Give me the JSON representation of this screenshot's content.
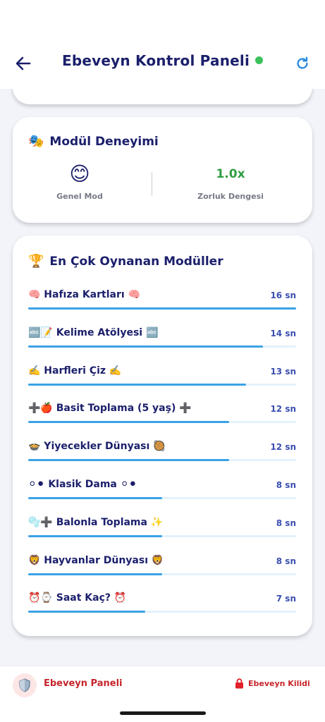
{
  "header": {
    "title": "Ebeveyn Kontrol Paneli",
    "back_icon": "arrow-left-icon",
    "refresh_icon": "refresh-icon",
    "status_color": "#3cc15a"
  },
  "module_experience": {
    "title": "Modül Deneyimi",
    "title_emoji": "🎭",
    "mode_emoji": "😊",
    "mode_label": "Genel Mod",
    "difficulty_value": "1.0x",
    "difficulty_label": "Zorluk Dengesi"
  },
  "top_modules": {
    "title": "En Çok Oynanan Modüller",
    "title_emoji": "🏆",
    "items": [
      {
        "name": "🧠 Hafıza Kartları 🧠",
        "value": "16 sn",
        "seconds": 16
      },
      {
        "name": "🔤📝 Kelime Atölyesi 🔤",
        "value": "14 sn",
        "seconds": 14
      },
      {
        "name": "✍️ Harfleri Çiz ✍️",
        "value": "13 sn",
        "seconds": 13
      },
      {
        "name": "➕🍎 Basit Toplama (5 yaş) ➕",
        "value": "12 sn",
        "seconds": 12
      },
      {
        "name": "🍲 Yiyecekler Dünyası 🥘",
        "value": "12 sn",
        "seconds": 12
      },
      {
        "name": "⚪⚫ Klasik Dama ⚪⚫",
        "value": "8 sn",
        "seconds": 8
      },
      {
        "name": "🫧➕ Balonla Toplama ✨",
        "value": "8 sn",
        "seconds": 8
      },
      {
        "name": "🦁 Hayvanlar Dünyası 🦁",
        "value": "8 sn",
        "seconds": 8
      },
      {
        "name": "⏰⌚ Saat Kaç? ⏰",
        "value": "7 sn",
        "seconds": 7
      }
    ],
    "max_seconds": 16,
    "bar_color": "#3aa2e6",
    "track_color": "#e3f2fb"
  },
  "bottom_bar": {
    "left_label": "Ebeveyn Paneli",
    "left_icon": "shield-icon",
    "right_label": "Ebeveyn Kilidi",
    "right_icon": "lock-icon",
    "accent_color": "#c6252b"
  }
}
